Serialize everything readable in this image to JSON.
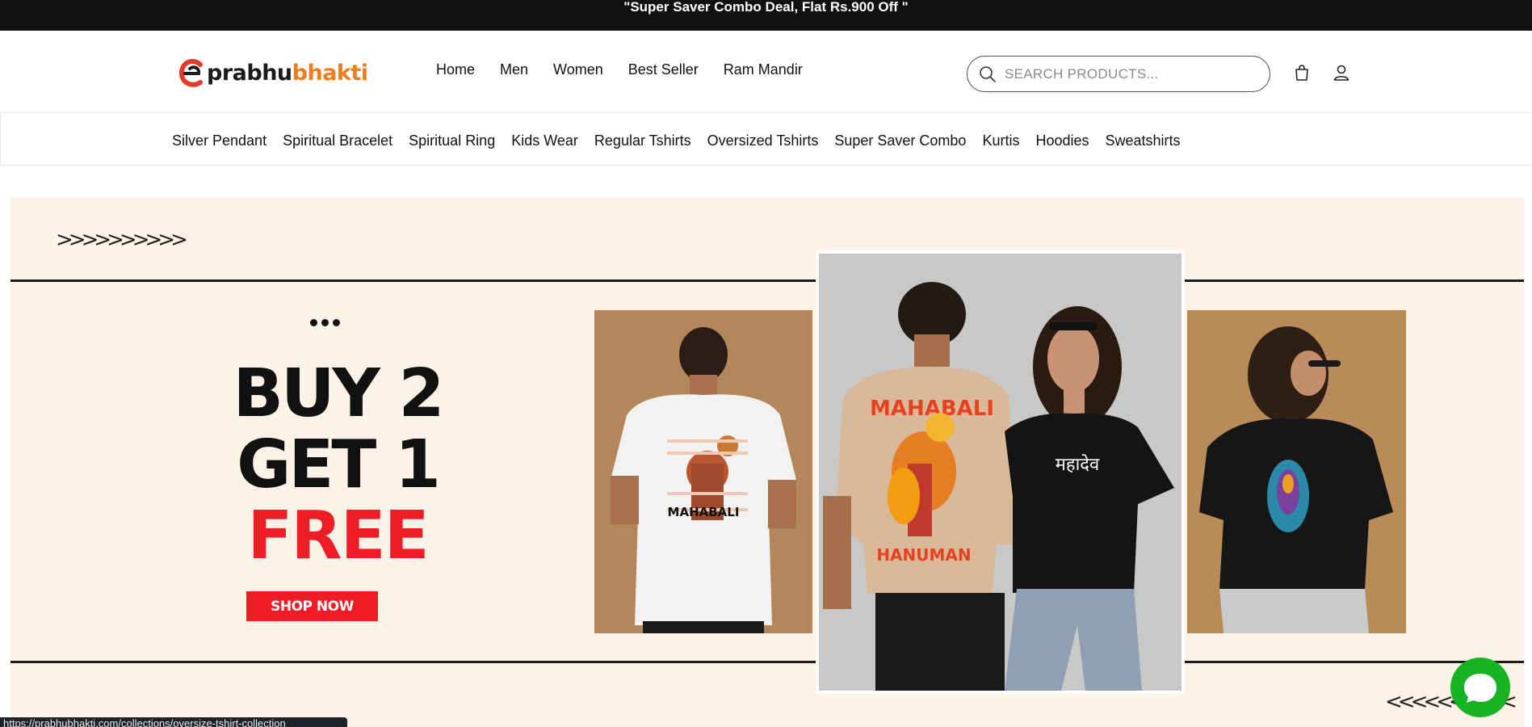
{
  "announcement": "\"Super Saver Combo Deal, Flat Rs.900 Off \"",
  "brand": {
    "part1": "prabhu",
    "part2": "bhakti"
  },
  "main_nav": [
    "Home",
    "Men",
    "Women",
    "Best Seller",
    "Ram Mandir"
  ],
  "search": {
    "placeholder": "SEARCH PRODUCTS..."
  },
  "header_icons": [
    "search-icon",
    "cart-icon",
    "account-icon"
  ],
  "categories": [
    "Silver Pendant",
    "Spiritual Bracelet",
    "Spiritual Ring",
    "Kids Wear",
    "Regular Tshirts",
    "Oversized Tshirts",
    "Super Saver Combo",
    "Kurtis",
    "Hoodies",
    "Sweatshirts"
  ],
  "hero": {
    "arrows_left": ">>>>>>>>>>",
    "arrows_right": "<<<<<<<<<<",
    "line1": "BUY 2",
    "line2": "GET 1",
    "line3": "FREE",
    "cta": "SHOP NOW",
    "shirt1_text": "MAHABALI",
    "shirt2_text_top": "MAHABALI",
    "shirt2_text_bottom": "HANUMAN",
    "shirt3_text": "महादेव"
  },
  "colors": {
    "accent_red": "#ee1c25",
    "brand_orange": "#f07c1b",
    "hero_bg": "#fdf2e8",
    "chat_green": "#17b323"
  },
  "status_url": "https://prabhubhakti.com/collections/oversize-tshirt-collection"
}
